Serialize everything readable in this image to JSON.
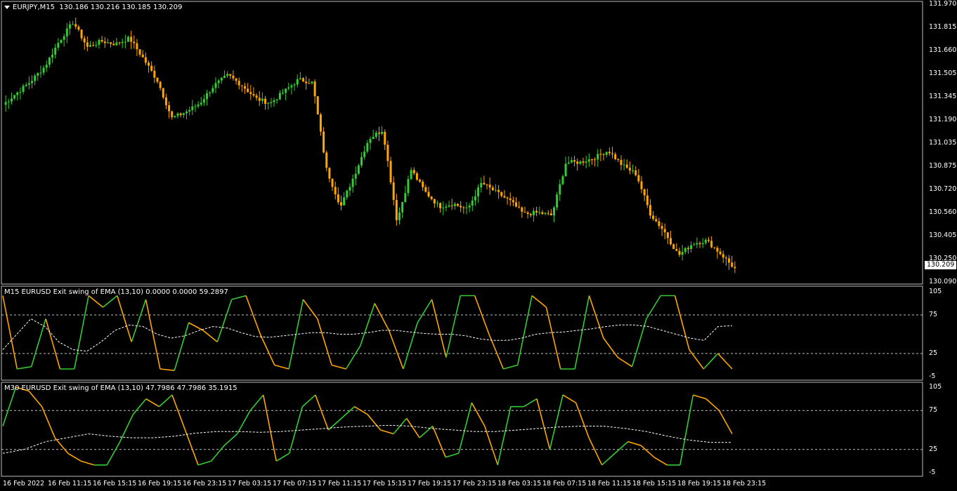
{
  "main": {
    "symbol": "EURJPY,M15",
    "ohlc": "130.186 130.216 130.185 130.209",
    "current_price": "130.209",
    "price_ticks": [
      "131.970",
      "131.815",
      "131.660",
      "131.505",
      "131.345",
      "131.190",
      "131.035",
      "130.875",
      "130.720",
      "130.560",
      "130.405",
      "130.250",
      "130.090"
    ],
    "ylim": [
      130.09,
      131.97
    ]
  },
  "sub1": {
    "title": "M15 EURUSD Exit swing of EMA (13,10) 0.0000 0.0000 59.2897",
    "ticks": [
      "105",
      "75",
      "25",
      "-5"
    ],
    "overlap_tick": "0"
  },
  "sub2": {
    "title": "M30 EURUSD Exit swing of EMA (13,10) 47.7986 47.7986 35.1915",
    "ticks": [
      "105",
      "75",
      "25",
      "-5"
    ],
    "overlap_tick": "0"
  },
  "time_axis": [
    "16 Feb 2022",
    "16 Feb 11:15",
    "16 Feb 15:15",
    "16 Feb 19:15",
    "16 Feb 23:15",
    "17 Feb 03:15",
    "17 Feb 07:15",
    "17 Feb 11:15",
    "17 Feb 15:15",
    "17 Feb 19:15",
    "17 Feb 23:15",
    "18 Feb 03:15",
    "18 Feb 07:15",
    "18 Feb 11:15",
    "18 Feb 15:15",
    "18 Feb 19:15",
    "18 Feb 23:15"
  ],
  "colors": {
    "bull": "#32cd32",
    "bear": "#ffa500",
    "grid": "#c0c0c0",
    "bg": "#000000",
    "dashed": "#ffffff"
  },
  "chart_data": [
    {
      "type": "candlestick",
      "title": "EURJPY,M15",
      "ylim": [
        130.09,
        131.97
      ],
      "close_path": [
        131.29,
        131.37,
        131.45,
        131.55,
        131.72,
        131.85,
        131.68,
        131.72,
        131.7,
        131.74,
        131.6,
        131.45,
        131.2,
        131.24,
        131.3,
        131.42,
        131.49,
        131.42,
        131.33,
        131.3,
        131.38,
        131.46,
        131.44,
        130.85,
        130.6,
        130.82,
        131.06,
        131.12,
        130.5,
        130.85,
        130.7,
        130.6,
        130.62,
        130.58,
        130.76,
        130.7,
        130.64,
        130.55,
        130.56,
        130.54,
        130.9,
        130.9,
        130.93,
        130.98,
        130.88,
        130.82,
        130.55,
        130.43,
        130.27,
        130.35,
        130.37,
        130.28,
        130.18
      ]
    },
    {
      "type": "line",
      "title": "M15 EURUSD Exit swing of EMA (13,10)",
      "ylim": [
        -5,
        105
      ],
      "values": [
        100,
        5,
        8,
        70,
        5,
        5,
        100,
        85,
        100,
        40,
        95,
        5,
        3,
        65,
        55,
        40,
        95,
        100,
        50,
        10,
        5,
        95,
        70,
        10,
        5,
        35,
        90,
        55,
        5,
        65,
        95,
        20,
        100,
        100,
        50,
        5,
        10,
        100,
        85,
        5,
        5,
        100,
        45,
        20,
        8,
        70,
        100,
        100,
        30,
        5,
        25,
        5
      ],
      "signal": [
        30,
        50,
        70,
        60,
        40,
        30,
        28,
        40,
        55,
        62,
        60,
        50,
        45,
        48,
        55,
        60,
        58,
        52,
        47,
        46,
        48,
        50,
        52,
        52,
        50,
        50,
        52,
        55,
        55,
        53,
        51,
        50,
        50,
        48,
        44,
        42,
        42,
        45,
        50,
        52,
        53,
        55,
        57,
        60,
        62,
        62,
        60,
        55,
        50,
        45,
        42,
        60,
        61
      ]
    },
    {
      "type": "line",
      "title": "M30 EURUSD Exit swing of EMA (13,10)",
      "ylim": [
        -5,
        105
      ],
      "values": [
        55,
        105,
        100,
        80,
        40,
        20,
        10,
        5,
        5,
        35,
        70,
        90,
        80,
        95,
        50,
        5,
        10,
        30,
        45,
        75,
        95,
        10,
        20,
        80,
        95,
        50,
        65,
        80,
        70,
        50,
        45,
        65,
        40,
        55,
        15,
        20,
        85,
        55,
        5,
        80,
        80,
        90,
        25,
        95,
        85,
        40,
        5,
        20,
        35,
        30,
        15,
        5,
        5,
        95,
        90,
        75,
        45
      ],
      "signal": [
        20,
        25,
        35,
        40,
        45,
        42,
        40,
        40,
        42,
        46,
        48,
        48,
        47,
        48,
        50,
        52,
        54,
        55,
        56,
        55,
        52,
        50,
        48,
        48,
        50,
        52,
        54,
        55,
        55,
        52,
        48,
        42,
        37,
        34,
        34
      ]
    }
  ]
}
